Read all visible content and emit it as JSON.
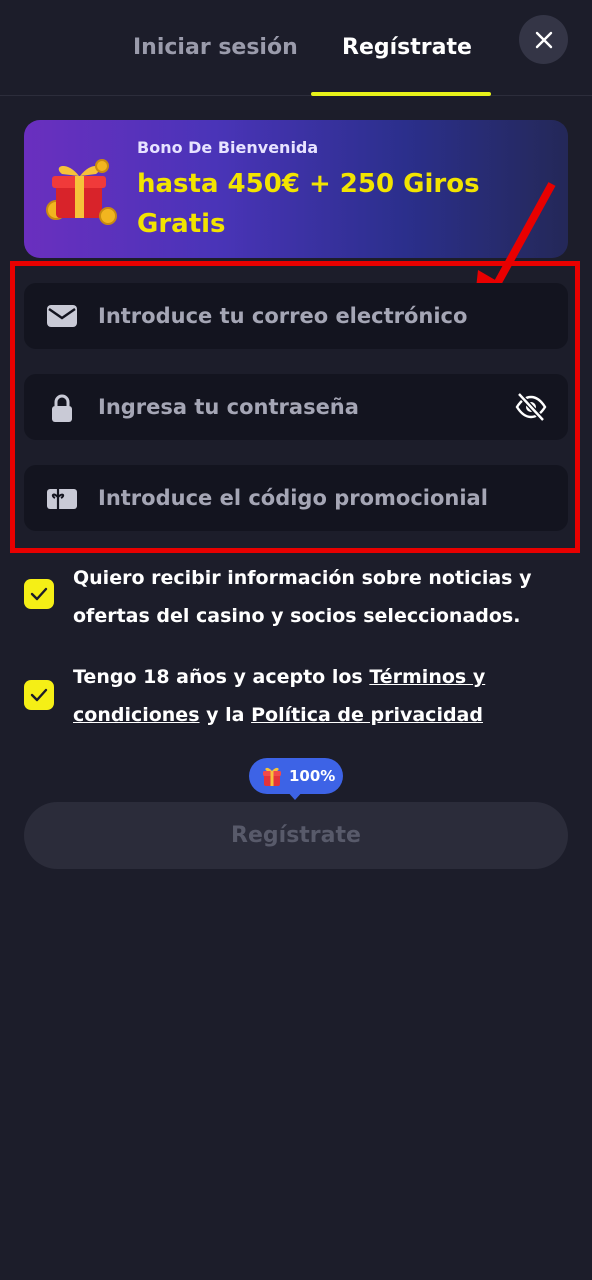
{
  "tabs": {
    "login_label": "Iniciar sesión",
    "register_label": "Regístrate"
  },
  "banner": {
    "subtitle": "Bono De Bienvenida",
    "title": "hasta 450€ + 250 Giros Gratis"
  },
  "form": {
    "email_placeholder": "Introduce tu correo electrónico",
    "password_placeholder": "Ingresa tu contraseña",
    "promo_placeholder": "Introduce el código promocionial"
  },
  "consents": {
    "newsletter_text": "Quiero recibir información sobre noticias y ofertas del casino y socios seleccionados.",
    "age_prefix": "Tengo 18 años y acepto los ",
    "terms_link": "Términos y condiciones",
    "age_middle": " y la ",
    "privacy_link": "Política de privacidad",
    "newsletter_checked": true,
    "age_checked": true
  },
  "progress_badge": {
    "label": "100%",
    "value": 100
  },
  "submit_label": "Regístrate",
  "colors": {
    "accent": "#e7f21a",
    "checkbox": "#f5ef16",
    "highlight": "#e80000",
    "badge": "#3d63e6",
    "banner_title": "#f2e400"
  },
  "icons": [
    "close-icon",
    "gift-icon",
    "envelope-icon",
    "lock-icon",
    "eye-off-icon",
    "promo-card-icon",
    "check-icon",
    "arrow-annotation"
  ]
}
